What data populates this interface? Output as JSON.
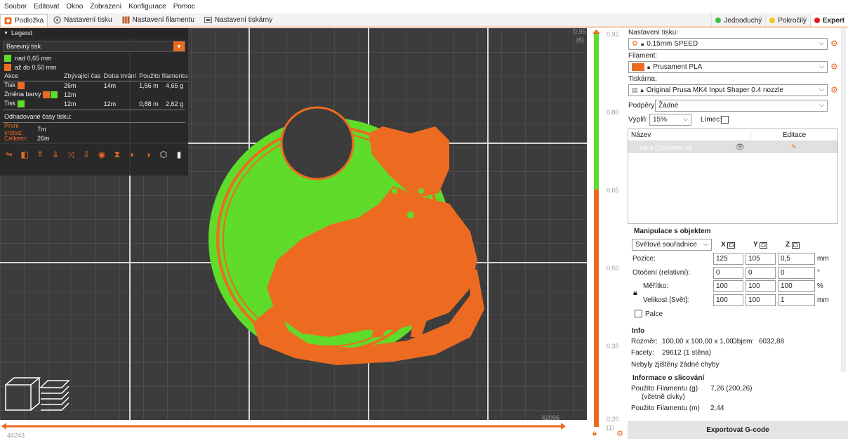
{
  "menu": [
    "Soubor",
    "Editovat",
    "Okno",
    "Zobrazení",
    "Konfigurace",
    "Pomoc"
  ],
  "tabs": [
    {
      "label": "Podložka",
      "icon": "bed-icon",
      "active": true
    },
    {
      "label": "Nastavení tisku",
      "icon": "print-settings-icon",
      "active": false
    },
    {
      "label": "Nastavení filamentu",
      "icon": "filament-icon",
      "active": false
    },
    {
      "label": "Nastavení tiskárny",
      "icon": "printer-icon",
      "active": false
    }
  ],
  "modes": [
    {
      "label": "Jednoduchý",
      "color": "#3cc33c"
    },
    {
      "label": "Pokročilý",
      "color": "#f2c81e"
    },
    {
      "label": "Expert",
      "color": "#e01a1a"
    }
  ],
  "legend": {
    "title": "Legend",
    "view_type": "Barevný tisk",
    "ranges": [
      {
        "label": "nad 0,65 mm",
        "color": "#5fdc2a"
      },
      {
        "label": "až do 0,50 mm",
        "color": "#ed6b21"
      }
    ],
    "table_headers": [
      "Akce",
      "Zbývající čas",
      "Doba trvání",
      "Použito filamentu"
    ],
    "rows": [
      {
        "action": "Tisk",
        "remaining": "26m",
        "duration": "14m",
        "used_len": "1,56 m",
        "used_g": "4,65 g"
      },
      {
        "action": "Změna barvy",
        "remaining": "12m",
        "duration": "",
        "used_len": "",
        "used_g": ""
      },
      {
        "action": "Tisk",
        "remaining": "12m",
        "duration": "12m",
        "used_len": "0,88 m",
        "used_g": "2,62 g"
      }
    ],
    "estimated_title": "Odhadované časy tisku:",
    "first_layer_label": "První vrstva:",
    "first_layer_value": "7m",
    "total_label": "Celkem:",
    "total_value": "26m"
  },
  "viewport": {
    "horizontal_value_left": "44243",
    "horizontal_value_right": "62095"
  },
  "vertical_slider": {
    "top_value": "0,95",
    "top_layer": "(6)",
    "bottom_value": "0,20",
    "bottom_layer": "(1)",
    "ticks": [
      "0,95",
      "0,80",
      "0,65",
      "0,50",
      "0,35",
      "0,20"
    ],
    "color_change_at": "0,65"
  },
  "rightpanel": {
    "print_settings_label": "Nastavení tisku:",
    "print_settings_value": "0.15mm SPEED",
    "filament_label": "Filament:",
    "filament_value": "Prusament PLA",
    "filament_color": "#ed6b21",
    "printer_label": "Tiskárna:",
    "printer_value": "Original Prusa MK4 Input Shaper 0.4 nozzle",
    "supports_label": "Podpěry:",
    "supports_value": "Žádné",
    "infill_label": "Výplň:",
    "infill_value": "15%",
    "brim_label": "Límec:",
    "list_col_name": "Název",
    "list_col_edit": "Editace",
    "object_name": "kuna (1)coaster.stl",
    "manip_title": "Manipulace s objektem",
    "coord_system": "Světové souřadnice",
    "axis_x": "X",
    "axis_y": "Y",
    "axis_z": "Z",
    "position_label": "Pozice:",
    "pos_x": "125",
    "pos_y": "105",
    "pos_z": "0,5",
    "pos_unit": "mm",
    "rotation_label": "Otočení (relativní):",
    "rot_x": "0",
    "rot_y": "0",
    "rot_z": "0",
    "rot_unit": "°",
    "scale_label": "Měřítko:",
    "scale_x": "100",
    "scale_y": "100",
    "scale_z": "100",
    "scale_unit": "%",
    "size_label": "Velikost [Svět]:",
    "size_x": "100",
    "size_y": "100",
    "size_z": "1",
    "size_unit": "mm",
    "inches_label": "Palce",
    "info_title": "Info",
    "size_info_label": "Rozměr:",
    "size_info_value": "100,00 x 100,00 x 1,00",
    "volume_label": "Objem:",
    "volume_value": "6032,88",
    "facets_label": "Facety:",
    "facets_value": "29612 (1 stěna)",
    "errors_text": "Nebyly zjištěny žádné chyby",
    "slice_title": "Informace o slicování",
    "filament_g_label": "Použito Filamentu (g)",
    "filament_g_value": "7,26 (200,26)",
    "including_spool": "(včetně cívky)",
    "filament_m_label": "Použito Filamentu (m)",
    "filament_m_value": "2,44",
    "export_label": "Exportovat G-code"
  },
  "colors": {
    "accent": "#ed6b21",
    "green": "#5fdc2a",
    "bed": "#3a3a3a"
  }
}
